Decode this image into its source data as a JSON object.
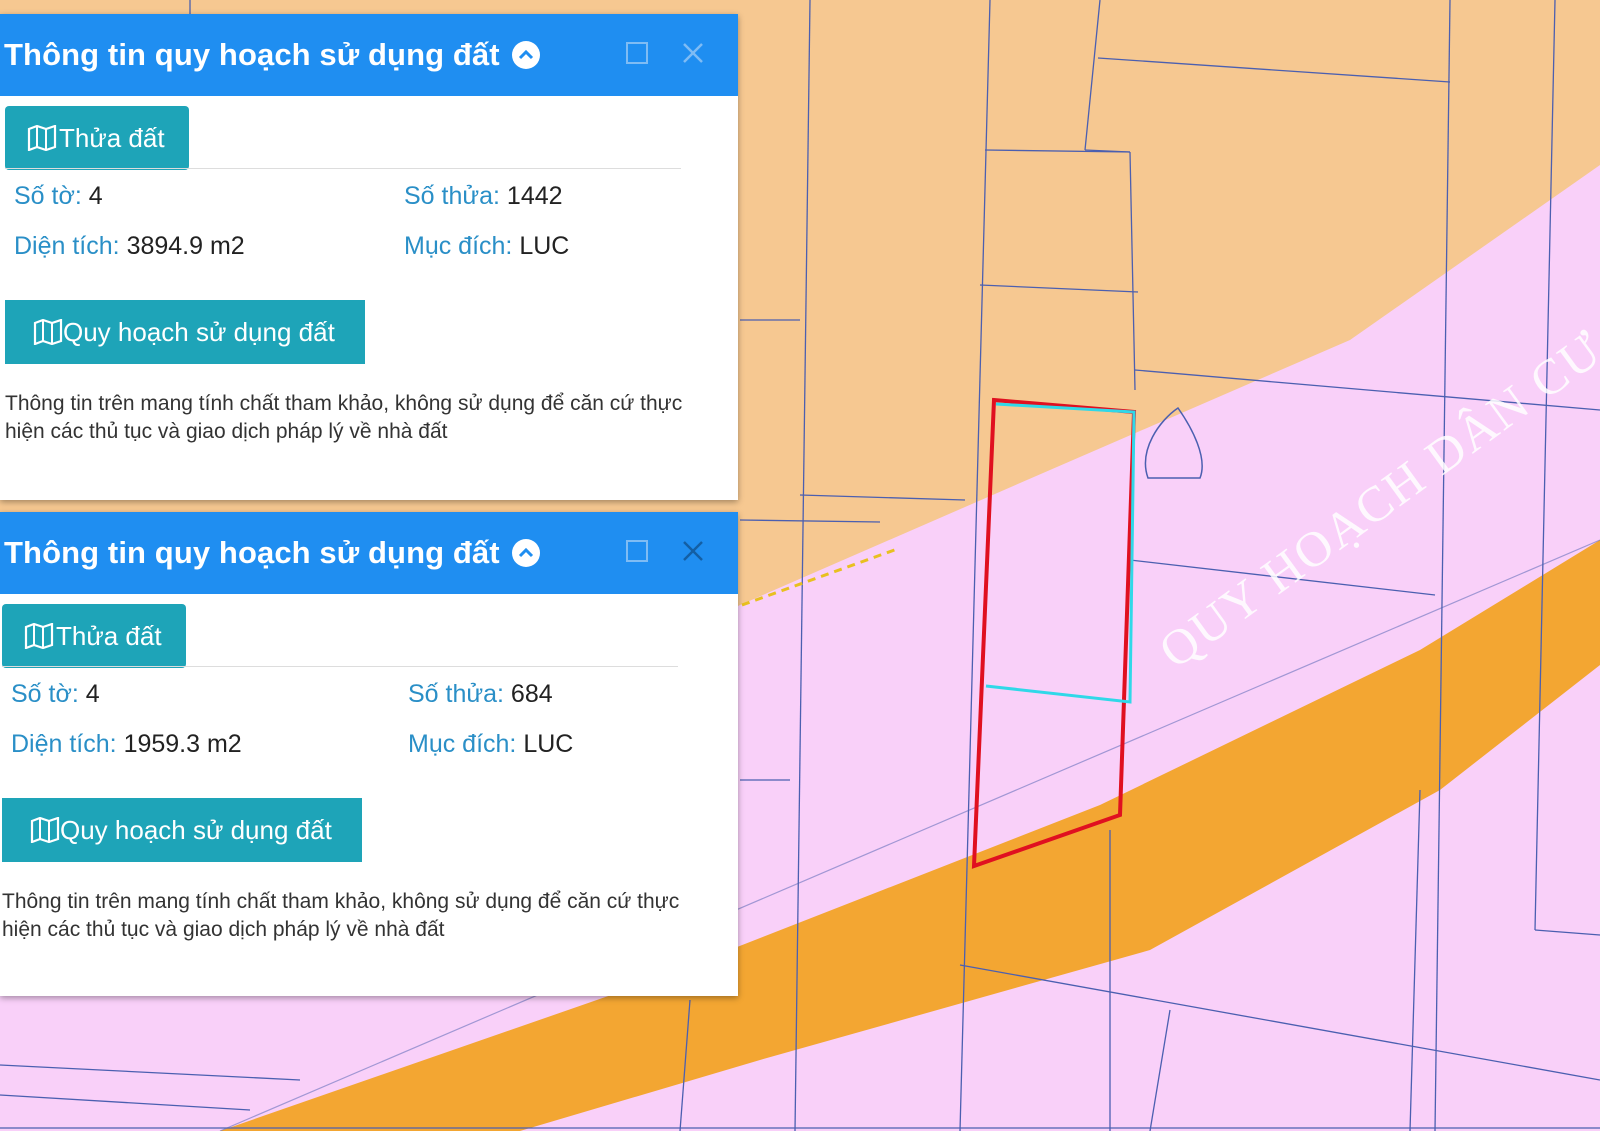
{
  "map": {
    "zone_label": "QUY HOẠCH DÂN CƯ",
    "colors": {
      "agricultural": "#f6c891",
      "residential": "#f9d0f9",
      "road": "#f3a632",
      "parcel_line": "#4b5fb0",
      "highlight": "#e01020",
      "cyan_line": "#30d8e8"
    }
  },
  "panels": [
    {
      "title": "Thông tin quy hoạch sử dụng đất",
      "tab_label": "Thửa đất",
      "so_to_label": "Số tờ:",
      "so_to_value": "4",
      "so_thua_label": "Số thửa:",
      "so_thua_value": "1442",
      "dien_tich_label": "Diện tích:",
      "dien_tich_value": "3894.9 m2",
      "muc_dich_label": "Mục đích:",
      "muc_dich_value": "LUC",
      "action_label": "Quy hoạch sử dụng đất",
      "note": "Thông tin trên mang tính chất tham khảo, không sử dụng để căn cứ thực hiện các thủ tục và giao dịch pháp lý về nhà đất"
    },
    {
      "title": "Thông tin quy hoạch sử dụng đất",
      "tab_label": "Thửa đất",
      "so_to_label": "Số tờ:",
      "so_to_value": "4",
      "so_thua_label": "Số thửa:",
      "so_thua_value": "684",
      "dien_tich_label": "Diện tích:",
      "dien_tich_value": "1959.3 m2",
      "muc_dich_label": "Mục đích:",
      "muc_dich_value": "LUC",
      "action_label": "Quy hoạch sử dụng đất",
      "note": "Thông tin trên mang tính chất tham khảo, không sử dụng để căn cứ thực hiện các thủ tục và giao dịch pháp lý về nhà đất"
    }
  ]
}
